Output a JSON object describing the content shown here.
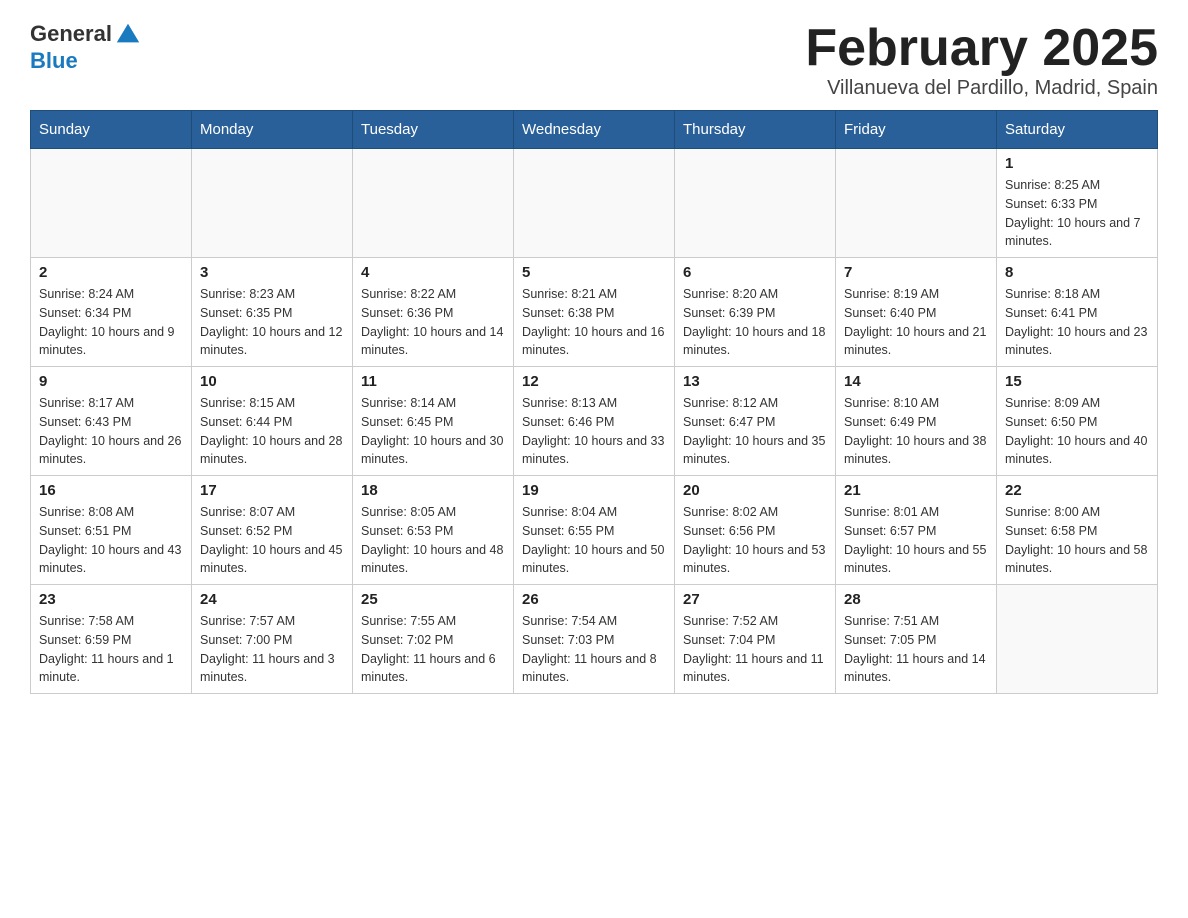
{
  "logo": {
    "general": "General",
    "blue": "Blue"
  },
  "title": "February 2025",
  "subtitle": "Villanueva del Pardillo, Madrid, Spain",
  "days_of_week": [
    "Sunday",
    "Monday",
    "Tuesday",
    "Wednesday",
    "Thursday",
    "Friday",
    "Saturday"
  ],
  "weeks": [
    [
      {
        "day": "",
        "info": ""
      },
      {
        "day": "",
        "info": ""
      },
      {
        "day": "",
        "info": ""
      },
      {
        "day": "",
        "info": ""
      },
      {
        "day": "",
        "info": ""
      },
      {
        "day": "",
        "info": ""
      },
      {
        "day": "1",
        "info": "Sunrise: 8:25 AM\nSunset: 6:33 PM\nDaylight: 10 hours and 7 minutes."
      }
    ],
    [
      {
        "day": "2",
        "info": "Sunrise: 8:24 AM\nSunset: 6:34 PM\nDaylight: 10 hours and 9 minutes."
      },
      {
        "day": "3",
        "info": "Sunrise: 8:23 AM\nSunset: 6:35 PM\nDaylight: 10 hours and 12 minutes."
      },
      {
        "day": "4",
        "info": "Sunrise: 8:22 AM\nSunset: 6:36 PM\nDaylight: 10 hours and 14 minutes."
      },
      {
        "day": "5",
        "info": "Sunrise: 8:21 AM\nSunset: 6:38 PM\nDaylight: 10 hours and 16 minutes."
      },
      {
        "day": "6",
        "info": "Sunrise: 8:20 AM\nSunset: 6:39 PM\nDaylight: 10 hours and 18 minutes."
      },
      {
        "day": "7",
        "info": "Sunrise: 8:19 AM\nSunset: 6:40 PM\nDaylight: 10 hours and 21 minutes."
      },
      {
        "day": "8",
        "info": "Sunrise: 8:18 AM\nSunset: 6:41 PM\nDaylight: 10 hours and 23 minutes."
      }
    ],
    [
      {
        "day": "9",
        "info": "Sunrise: 8:17 AM\nSunset: 6:43 PM\nDaylight: 10 hours and 26 minutes."
      },
      {
        "day": "10",
        "info": "Sunrise: 8:15 AM\nSunset: 6:44 PM\nDaylight: 10 hours and 28 minutes."
      },
      {
        "day": "11",
        "info": "Sunrise: 8:14 AM\nSunset: 6:45 PM\nDaylight: 10 hours and 30 minutes."
      },
      {
        "day": "12",
        "info": "Sunrise: 8:13 AM\nSunset: 6:46 PM\nDaylight: 10 hours and 33 minutes."
      },
      {
        "day": "13",
        "info": "Sunrise: 8:12 AM\nSunset: 6:47 PM\nDaylight: 10 hours and 35 minutes."
      },
      {
        "day": "14",
        "info": "Sunrise: 8:10 AM\nSunset: 6:49 PM\nDaylight: 10 hours and 38 minutes."
      },
      {
        "day": "15",
        "info": "Sunrise: 8:09 AM\nSunset: 6:50 PM\nDaylight: 10 hours and 40 minutes."
      }
    ],
    [
      {
        "day": "16",
        "info": "Sunrise: 8:08 AM\nSunset: 6:51 PM\nDaylight: 10 hours and 43 minutes."
      },
      {
        "day": "17",
        "info": "Sunrise: 8:07 AM\nSunset: 6:52 PM\nDaylight: 10 hours and 45 minutes."
      },
      {
        "day": "18",
        "info": "Sunrise: 8:05 AM\nSunset: 6:53 PM\nDaylight: 10 hours and 48 minutes."
      },
      {
        "day": "19",
        "info": "Sunrise: 8:04 AM\nSunset: 6:55 PM\nDaylight: 10 hours and 50 minutes."
      },
      {
        "day": "20",
        "info": "Sunrise: 8:02 AM\nSunset: 6:56 PM\nDaylight: 10 hours and 53 minutes."
      },
      {
        "day": "21",
        "info": "Sunrise: 8:01 AM\nSunset: 6:57 PM\nDaylight: 10 hours and 55 minutes."
      },
      {
        "day": "22",
        "info": "Sunrise: 8:00 AM\nSunset: 6:58 PM\nDaylight: 10 hours and 58 minutes."
      }
    ],
    [
      {
        "day": "23",
        "info": "Sunrise: 7:58 AM\nSunset: 6:59 PM\nDaylight: 11 hours and 1 minute."
      },
      {
        "day": "24",
        "info": "Sunrise: 7:57 AM\nSunset: 7:00 PM\nDaylight: 11 hours and 3 minutes."
      },
      {
        "day": "25",
        "info": "Sunrise: 7:55 AM\nSunset: 7:02 PM\nDaylight: 11 hours and 6 minutes."
      },
      {
        "day": "26",
        "info": "Sunrise: 7:54 AM\nSunset: 7:03 PM\nDaylight: 11 hours and 8 minutes."
      },
      {
        "day": "27",
        "info": "Sunrise: 7:52 AM\nSunset: 7:04 PM\nDaylight: 11 hours and 11 minutes."
      },
      {
        "day": "28",
        "info": "Sunrise: 7:51 AM\nSunset: 7:05 PM\nDaylight: 11 hours and 14 minutes."
      },
      {
        "day": "",
        "info": ""
      }
    ]
  ]
}
